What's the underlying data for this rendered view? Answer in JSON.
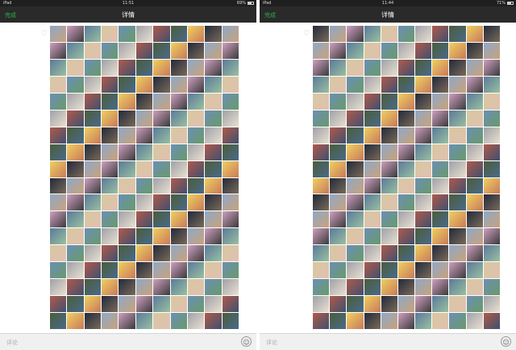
{
  "screens": [
    {
      "carrier": "iPad",
      "time": "11:51",
      "battery": "69%",
      "battery_level": 0.69,
      "done_label": "完成",
      "title": "详情",
      "input_placeholder": "评论",
      "heart_icon": "heart-outline-icon",
      "emoji_icon": "smiley-face-icon"
    },
    {
      "carrier": "iPad",
      "time": "11:44",
      "battery": "71%",
      "battery_level": 0.71,
      "done_label": "完成",
      "title": "详情",
      "input_placeholder": "评论",
      "heart_icon": "heart-outline-icon",
      "emoji_icon": "smiley-face-icon"
    }
  ],
  "colors": {
    "navbar": "#2a2a2a",
    "accent_green": "#2cb24a",
    "thumb_palette": [
      "#6b8fb5",
      "#c9a27a",
      "#4a5d3a",
      "#e0c0b0",
      "#8fa8c8",
      "#3f4f6f",
      "#d8c8a0",
      "#7a6a5a",
      "#b05a4a",
      "#9ac0a0",
      "#222a3a",
      "#e8e0d0",
      "#5a7a9a",
      "#c87a5a",
      "#a0a0a8",
      "#3a3a3a",
      "#f0d060",
      "#6a9a6a",
      "#d0a0c0",
      "#4a6a8a"
    ]
  }
}
